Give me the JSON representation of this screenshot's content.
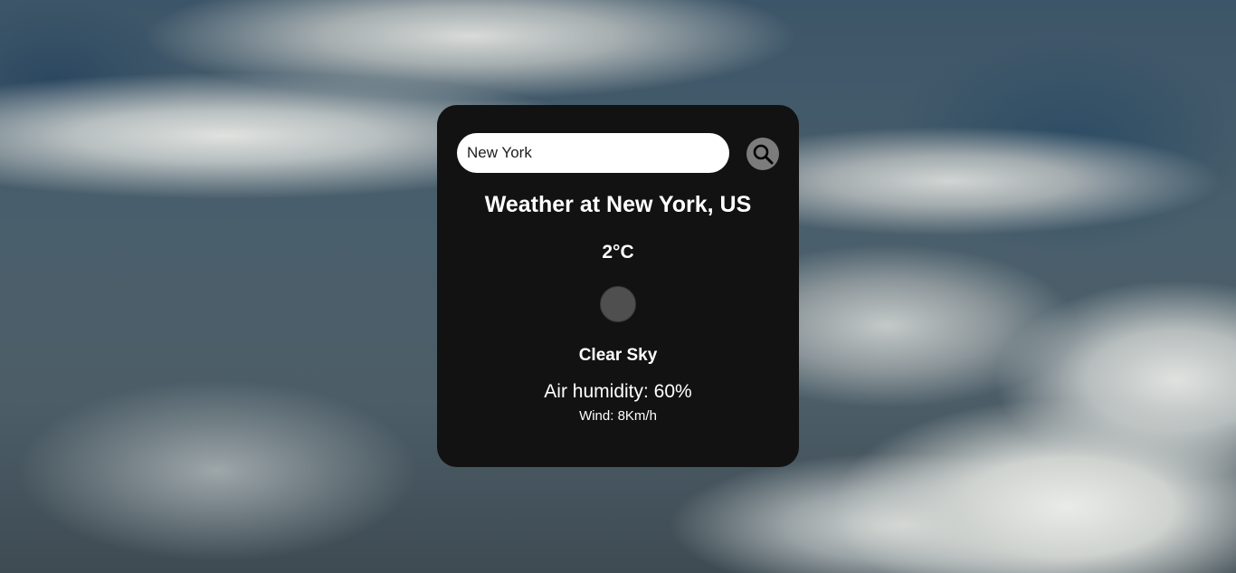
{
  "search": {
    "value": "New York",
    "icon": "search-icon"
  },
  "weather": {
    "title": "Weather at New York, US",
    "temperature": "2°C",
    "icon": "weather-icon",
    "description": "Clear Sky",
    "humidity": "Air humidity: 60%",
    "wind": "Wind: 8Km/h"
  },
  "colors": {
    "card_background": "#121212",
    "search_button": "#7c7c7c",
    "text": "#ffffff"
  }
}
